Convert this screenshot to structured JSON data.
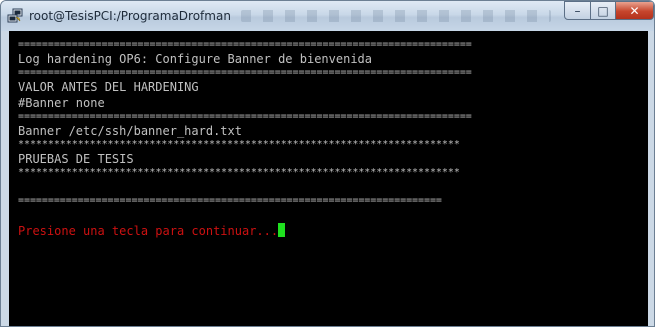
{
  "window": {
    "title": "root@TesisPCI:/ProgramaDrofman",
    "icon": "putty-icon",
    "buttons": {
      "minimize": "–",
      "maximize": "□",
      "close": "✕"
    }
  },
  "terminal": {
    "separator_eq_long": "============================================================================",
    "separator_eq_short": "=======================================================================",
    "separator_star": "**************************************************************************",
    "header_line": "Log hardening OP6: Configure Banner de bienvenida",
    "before_label": "VALOR ANTES DEL HARDENING",
    "before_value": "#Banner none",
    "after_value": "Banner /etc/ssh/banner_hard.txt",
    "banner_text": "PRUEBAS DE TESIS",
    "prompt": "Presione una tecla para continuar...",
    "colors": {
      "background": "#000000",
      "text": "#c0c0c0",
      "prompt": "#cc1111",
      "cursor": "#1fe01f"
    }
  }
}
